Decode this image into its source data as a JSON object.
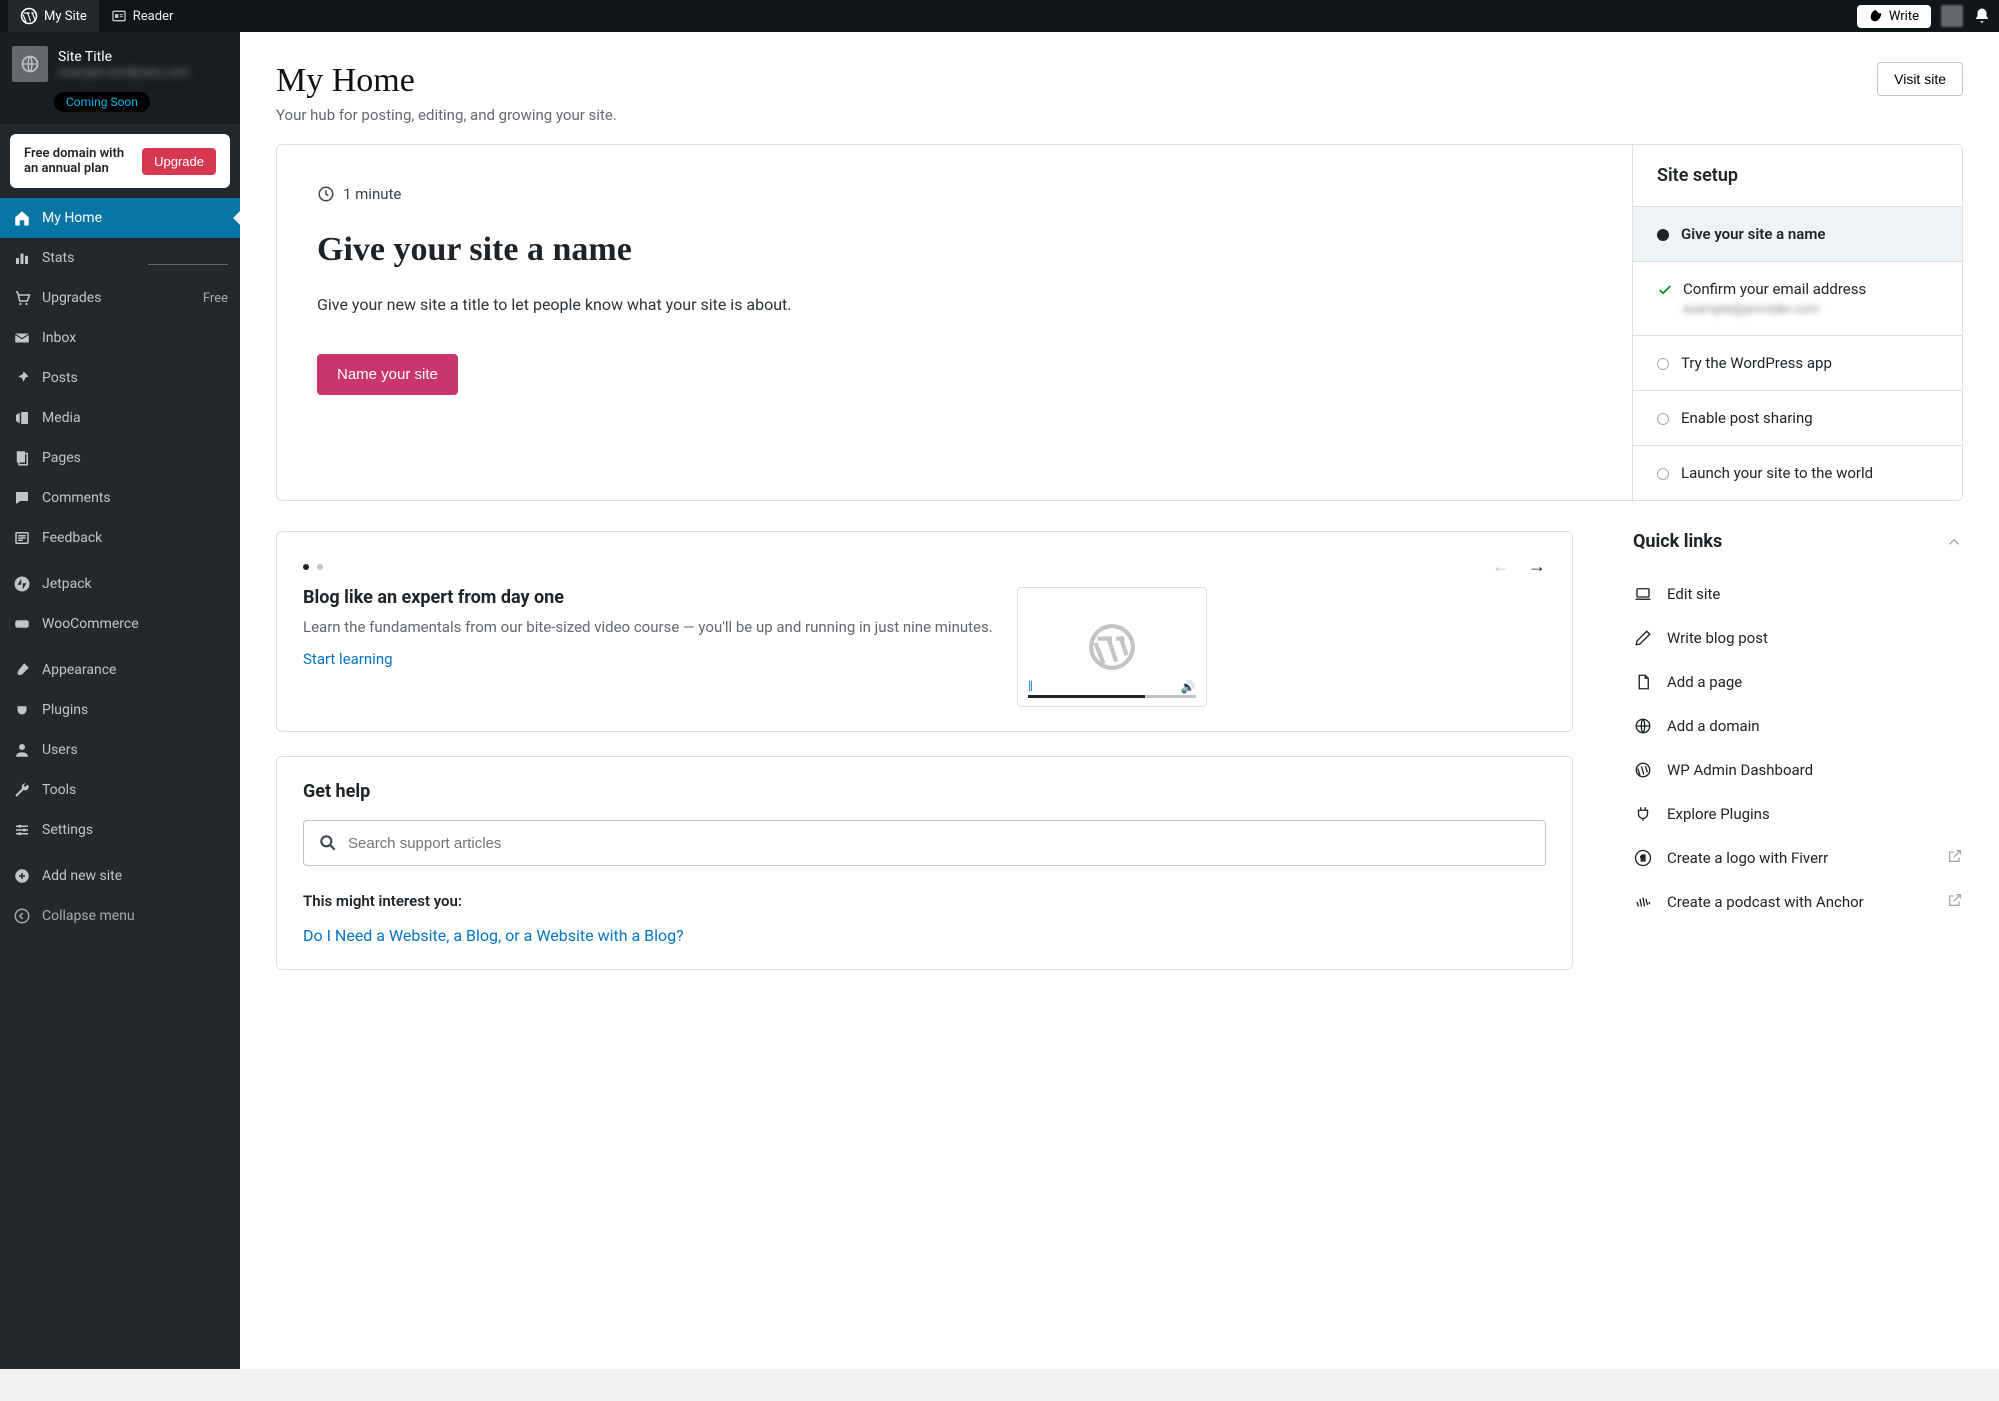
{
  "topbar": {
    "my_site": "My Site",
    "reader": "Reader",
    "write": "Write"
  },
  "site_card": {
    "title": "Site Title",
    "url_blur": "example.wordpress.com",
    "badge": "Coming Soon"
  },
  "upsell": {
    "text": "Free domain with an annual plan",
    "button": "Upgrade"
  },
  "nav": {
    "my_home": "My Home",
    "stats": "Stats",
    "upgrades": "Upgrades",
    "upgrades_tag": "Free",
    "inbox": "Inbox",
    "posts": "Posts",
    "media": "Media",
    "pages": "Pages",
    "comments": "Comments",
    "feedback": "Feedback",
    "jetpack": "Jetpack",
    "woocommerce": "WooCommerce",
    "appearance": "Appearance",
    "plugins": "Plugins",
    "users": "Users",
    "tools": "Tools",
    "settings": "Settings",
    "add_site": "Add new site",
    "collapse": "Collapse menu"
  },
  "page": {
    "title": "My Home",
    "subtitle": "Your hub for posting, editing, and growing your site.",
    "visit": "Visit site"
  },
  "task": {
    "time": "1 minute",
    "title": "Give your site a name",
    "desc": "Give your new site a title to let people know what your site is about.",
    "button": "Name your site"
  },
  "setup": {
    "heading": "Site setup",
    "items": {
      "name": "Give your site a name",
      "email": "Confirm your email address",
      "email_sub": "example@provider.com",
      "app": "Try the WordPress app",
      "sharing": "Enable post sharing",
      "launch": "Launch your site to the world"
    }
  },
  "carousel": {
    "title": "Blog like an expert from day one",
    "desc": "Learn the fundamentals from our bite-sized video course — you'll be up and running in just nine minutes.",
    "cta": "Start learning"
  },
  "quick": {
    "heading": "Quick links",
    "items": {
      "edit_site": "Edit site",
      "write_post": "Write blog post",
      "add_page": "Add a page",
      "add_domain": "Add a domain",
      "wp_admin": "WP Admin Dashboard",
      "plugins": "Explore Plugins",
      "fiverr": "Create a logo with Fiverr",
      "anchor": "Create a podcast with Anchor"
    }
  },
  "help": {
    "heading": "Get help",
    "placeholder": "Search support articles",
    "interest_heading": "This might interest you:",
    "article": "Do I Need a Website, a Blog, or a Website with a Blog?"
  }
}
